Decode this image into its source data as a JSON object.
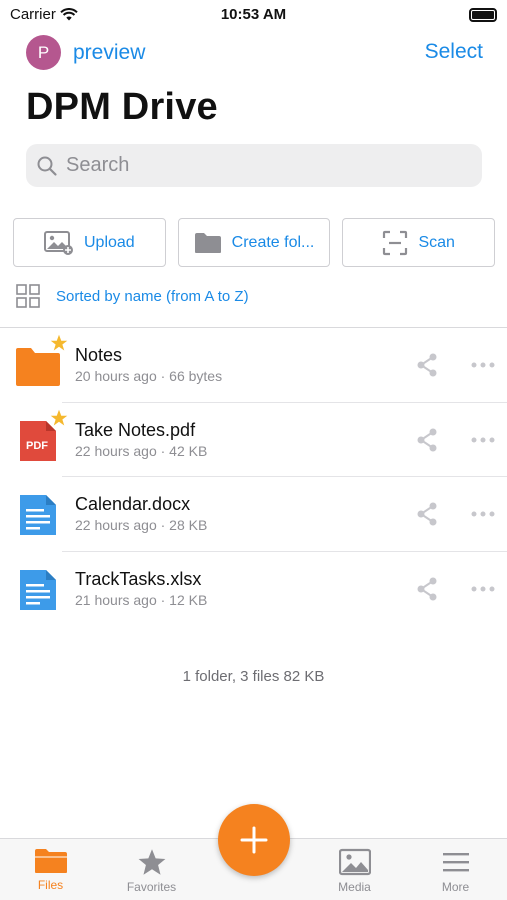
{
  "status_bar": {
    "carrier": "Carrier",
    "time": "10:53 AM"
  },
  "header": {
    "avatar_letter": "P",
    "account_name": "preview",
    "select_label": "Select",
    "title": "DPM Drive"
  },
  "search": {
    "placeholder": "Search"
  },
  "actions": {
    "upload_label": "Upload",
    "create_folder_label": "Create fol...",
    "scan_label": "Scan"
  },
  "sort": {
    "label": "Sorted by name (from A to Z)"
  },
  "files": [
    {
      "name": "Notes",
      "meta": "20 hours ago · 66 bytes",
      "type": "folder",
      "favorite": true
    },
    {
      "name": "Take Notes.pdf",
      "meta": "22 hours ago · 42 KB",
      "type": "pdf",
      "icon_text": "PDF",
      "favorite": true
    },
    {
      "name": "Calendar.docx",
      "meta": "22 hours ago · 28 KB",
      "type": "document",
      "favorite": false
    },
    {
      "name": "TrackTasks.xlsx",
      "meta": "21 hours ago · 12 KB",
      "type": "document",
      "favorite": false
    }
  ],
  "summary": "1 folder, 3 files 82 KB",
  "tabs": [
    {
      "label": "Files",
      "icon": "folder-icon",
      "active": true
    },
    {
      "label": "Favorites",
      "icon": "star-icon",
      "active": false
    },
    {
      "label": "Media",
      "icon": "image-icon",
      "active": false
    },
    {
      "label": "More",
      "icon": "menu-icon",
      "active": false
    }
  ],
  "colors": {
    "accent": "#1a8ae6",
    "orange": "#f5821f",
    "avatar": "#b5578f",
    "pdf_red": "#e04a3c",
    "doc_blue": "#3d9be9",
    "star": "#f5b82e"
  }
}
